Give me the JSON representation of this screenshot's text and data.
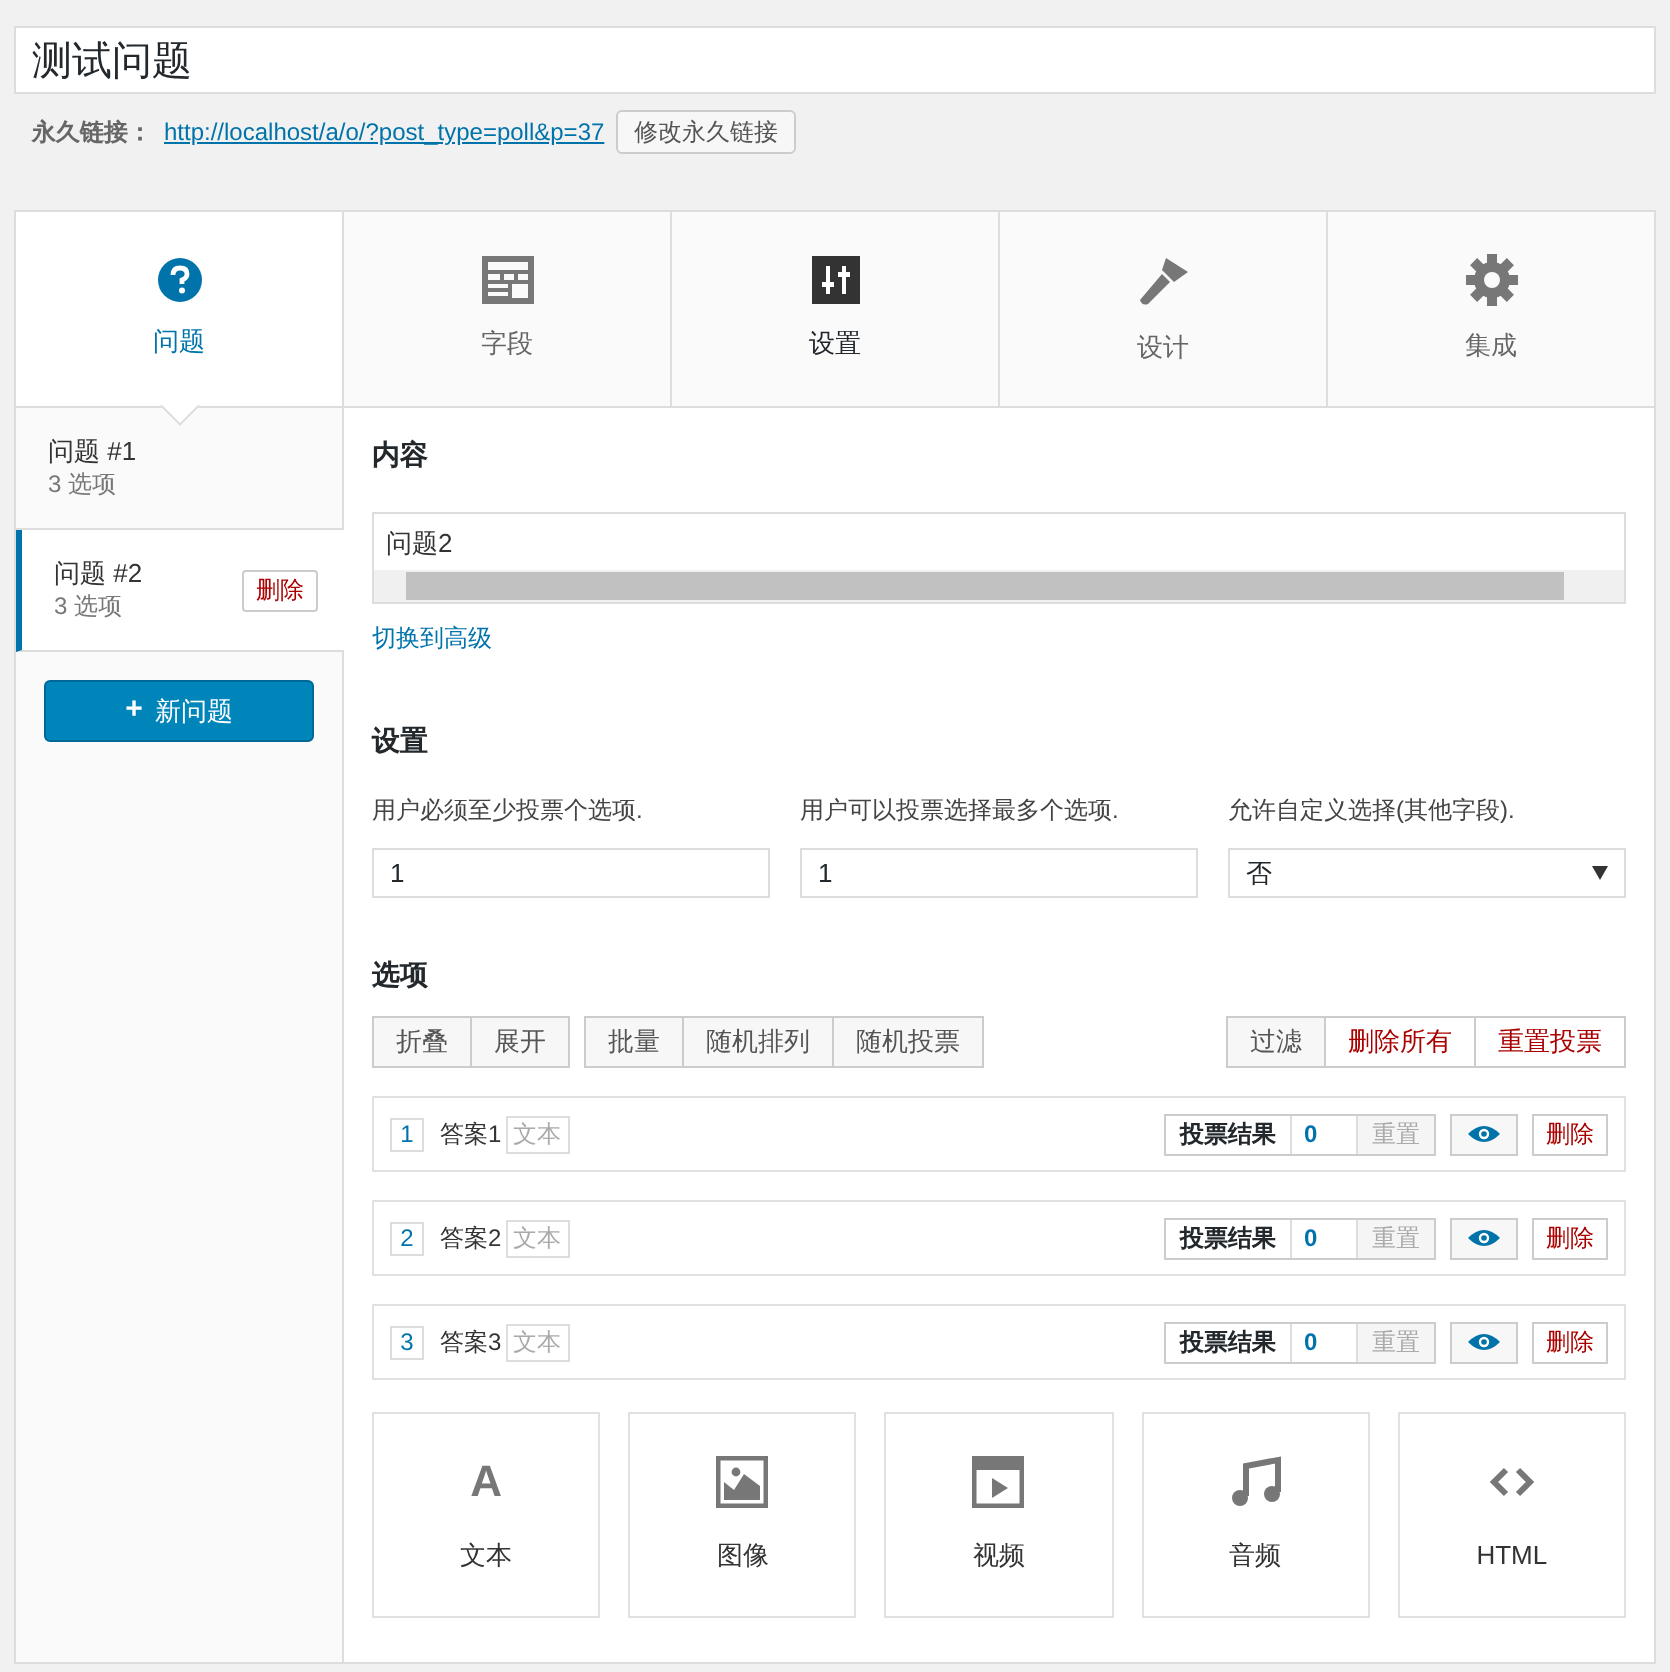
{
  "title": "测试问题",
  "permalink": {
    "label": "永久链接：",
    "url": "http://localhost/a/o/?post_type=poll&p=37",
    "button": "修改永久链接"
  },
  "tabs": [
    {
      "label": "问题",
      "selected": true,
      "highlighted": false
    },
    {
      "label": "字段",
      "selected": false,
      "highlighted": false
    },
    {
      "label": "设置",
      "selected": false,
      "highlighted": true
    },
    {
      "label": "设计",
      "selected": false,
      "highlighted": false
    },
    {
      "label": "集成",
      "selected": false,
      "highlighted": false
    }
  ],
  "questions": [
    {
      "title": "问题 #1",
      "count": "3 选项",
      "selected": false
    },
    {
      "title": "问题 #2",
      "count": "3 选项",
      "selected": true,
      "delete": "删除"
    }
  ],
  "new_question": {
    "icon": "+",
    "label": "新问题"
  },
  "content": {
    "heading": "内容",
    "value": "问题2",
    "link": "切换到高级"
  },
  "settings": {
    "heading": "设置",
    "fields": [
      {
        "kind": "input",
        "label": "用户必须至少投票个选项.",
        "value": "1"
      },
      {
        "kind": "input",
        "label": "用户可以投票选择最多个选项.",
        "value": "1"
      },
      {
        "kind": "select",
        "label": "允许自定义选择(其他字段).",
        "value": "否"
      }
    ]
  },
  "options": {
    "heading": "选项",
    "left_groups": [
      [
        "折叠",
        "展开"
      ],
      [
        "批量",
        "随机排列",
        "随机投票"
      ]
    ],
    "right_buttons": [
      {
        "label": "过滤",
        "danger": false
      },
      {
        "label": "删除所有",
        "danger": true
      },
      {
        "label": "重置投票",
        "danger": true
      }
    ],
    "answers": [
      {
        "number": "1",
        "label": "答案1",
        "type": "文本",
        "results": "投票结果",
        "votes": "0",
        "reset": "重置",
        "delete": "删除"
      },
      {
        "number": "2",
        "label": "答案2",
        "type": "文本",
        "results": "投票结果",
        "votes": "0",
        "reset": "重置",
        "delete": "删除"
      },
      {
        "number": "3",
        "label": "答案3",
        "type": "文本",
        "results": "投票结果",
        "votes": "0",
        "reset": "重置",
        "delete": "删除"
      }
    ],
    "add_types": [
      {
        "label": "文本",
        "glyph": "A"
      },
      {
        "label": "图像"
      },
      {
        "label": "视频"
      },
      {
        "label": "音频"
      },
      {
        "label": "HTML"
      }
    ]
  }
}
